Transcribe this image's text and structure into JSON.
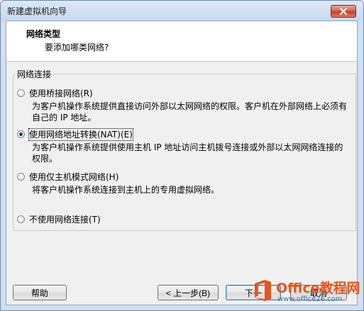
{
  "window": {
    "title": "新建虚拟机向导"
  },
  "header": {
    "title": "网络类型",
    "subtitle": "要添加哪类网络?"
  },
  "group": {
    "legend": "网络连接"
  },
  "options": [
    {
      "label": "使用桥接网络(R)",
      "description": "为客户机操作系统提供直接访问外部以太网网络的权限。客户机在外部网络上必须有自己的 IP 地址。",
      "selected": false
    },
    {
      "label": "使用网络地址转换(NAT)(E)",
      "description": "为客户机操作系统提供使用主机 IP 地址访问主机拨号连接或外部以太网网络连接的权限。",
      "selected": true
    },
    {
      "label": "使用仅主机模式网络(H)",
      "description": "将客户机操作系统连接到主机上的专用虚拟网络。",
      "selected": false
    },
    {
      "label": "不使用网络连接(T)",
      "description": "",
      "selected": false
    }
  ],
  "buttons": {
    "help": "帮助",
    "back": "< 上一步(B)",
    "next": "下一",
    "cancel": "取消"
  },
  "watermark": {
    "title": "Office教程网",
    "url": "www.office26.com"
  },
  "colors": {
    "title_bar": "#cfe0f2",
    "dialog_bg": "#f0f0f0",
    "selected_dot": "#1c3f73",
    "watermark_orange": "#e8541e",
    "watermark_blue": "#2b6fb6"
  },
  "icons": {
    "close": "close-icon",
    "watermark_logo": "office-logo-icon"
  }
}
